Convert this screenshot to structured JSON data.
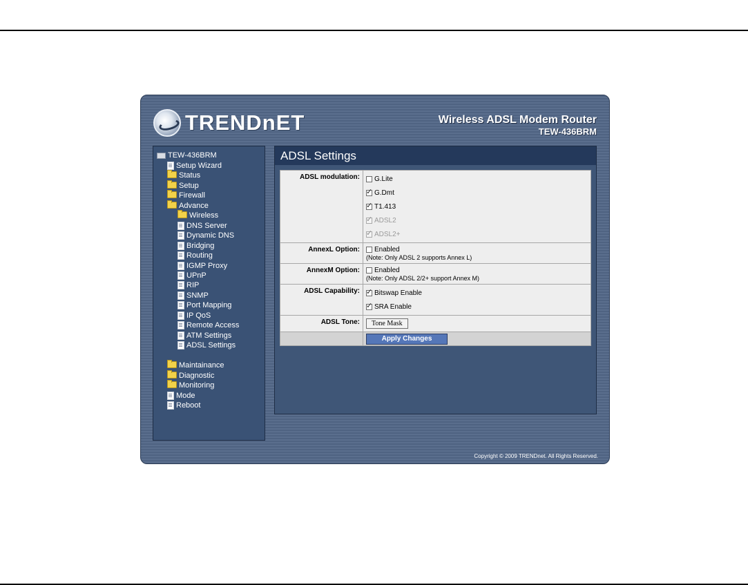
{
  "header": {
    "logo_text": "TRENDnET",
    "product_title": "Wireless ADSL Modem Router",
    "model": "TEW-436BRM"
  },
  "sidebar": {
    "root": "TEW-436BRM",
    "items": [
      {
        "label": "Setup Wizard",
        "icon": "doc-icon"
      },
      {
        "label": "Status",
        "icon": "folder-icon"
      },
      {
        "label": "Setup",
        "icon": "folder-icon"
      },
      {
        "label": "Firewall",
        "icon": "folder-icon"
      },
      {
        "label": "Advance",
        "icon": "folder-open-icon"
      },
      {
        "label": "Wireless",
        "icon": "folder-icon"
      },
      {
        "label": "DNS Server",
        "icon": "doc-icon"
      },
      {
        "label": "Dynamic DNS",
        "icon": "doc-icon"
      },
      {
        "label": "Bridging",
        "icon": "doc-icon"
      },
      {
        "label": "Routing",
        "icon": "doc-icon"
      },
      {
        "label": "IGMP Proxy",
        "icon": "doc-icon"
      },
      {
        "label": "UPnP",
        "icon": "doc-icon"
      },
      {
        "label": "RIP",
        "icon": "doc-icon"
      },
      {
        "label": "SNMP",
        "icon": "doc-icon"
      },
      {
        "label": "Port Mapping",
        "icon": "doc-icon"
      },
      {
        "label": "IP QoS",
        "icon": "doc-icon"
      },
      {
        "label": "Remote Access",
        "icon": "doc-icon"
      },
      {
        "label": "ATM Settings",
        "icon": "doc-icon"
      },
      {
        "label": "ADSL Settings",
        "icon": "doc-icon"
      },
      {
        "label": "Maintainance",
        "icon": "folder-icon"
      },
      {
        "label": "Diagnostic",
        "icon": "folder-icon"
      },
      {
        "label": "Monitoring",
        "icon": "folder-icon"
      },
      {
        "label": "Mode",
        "icon": "doc-icon"
      },
      {
        "label": "Reboot",
        "icon": "doc-icon"
      }
    ]
  },
  "page": {
    "title": "ADSL Settings",
    "modulation": {
      "label": "ADSL modulation:",
      "options": [
        {
          "label": "G.Lite",
          "checked": false,
          "disabled": false
        },
        {
          "label": "G.Dmt",
          "checked": true,
          "disabled": false
        },
        {
          "label": "T1.413",
          "checked": true,
          "disabled": false
        },
        {
          "label": "ADSL2",
          "checked": true,
          "disabled": true
        },
        {
          "label": "ADSL2+",
          "checked": true,
          "disabled": true
        }
      ]
    },
    "annexl": {
      "label": "AnnexL Option:",
      "option": "Enabled",
      "checked": false,
      "note": "(Note: Only ADSL 2 supports Annex L)"
    },
    "annexm": {
      "label": "AnnexM Option:",
      "option": "Enabled",
      "checked": false,
      "note": "(Note: Only ADSL 2/2+ support Annex M)"
    },
    "capability": {
      "label": "ADSL Capability:",
      "options": [
        {
          "label": "Bitswap Enable",
          "checked": true
        },
        {
          "label": "SRA Enable",
          "checked": true
        }
      ]
    },
    "tone": {
      "label": "ADSL Tone:",
      "button": "Tone Mask"
    },
    "apply_button": "Apply Changes"
  },
  "footer": {
    "copyright": "Copyright © 2009 TRENDnet. All Rights Reserved."
  }
}
